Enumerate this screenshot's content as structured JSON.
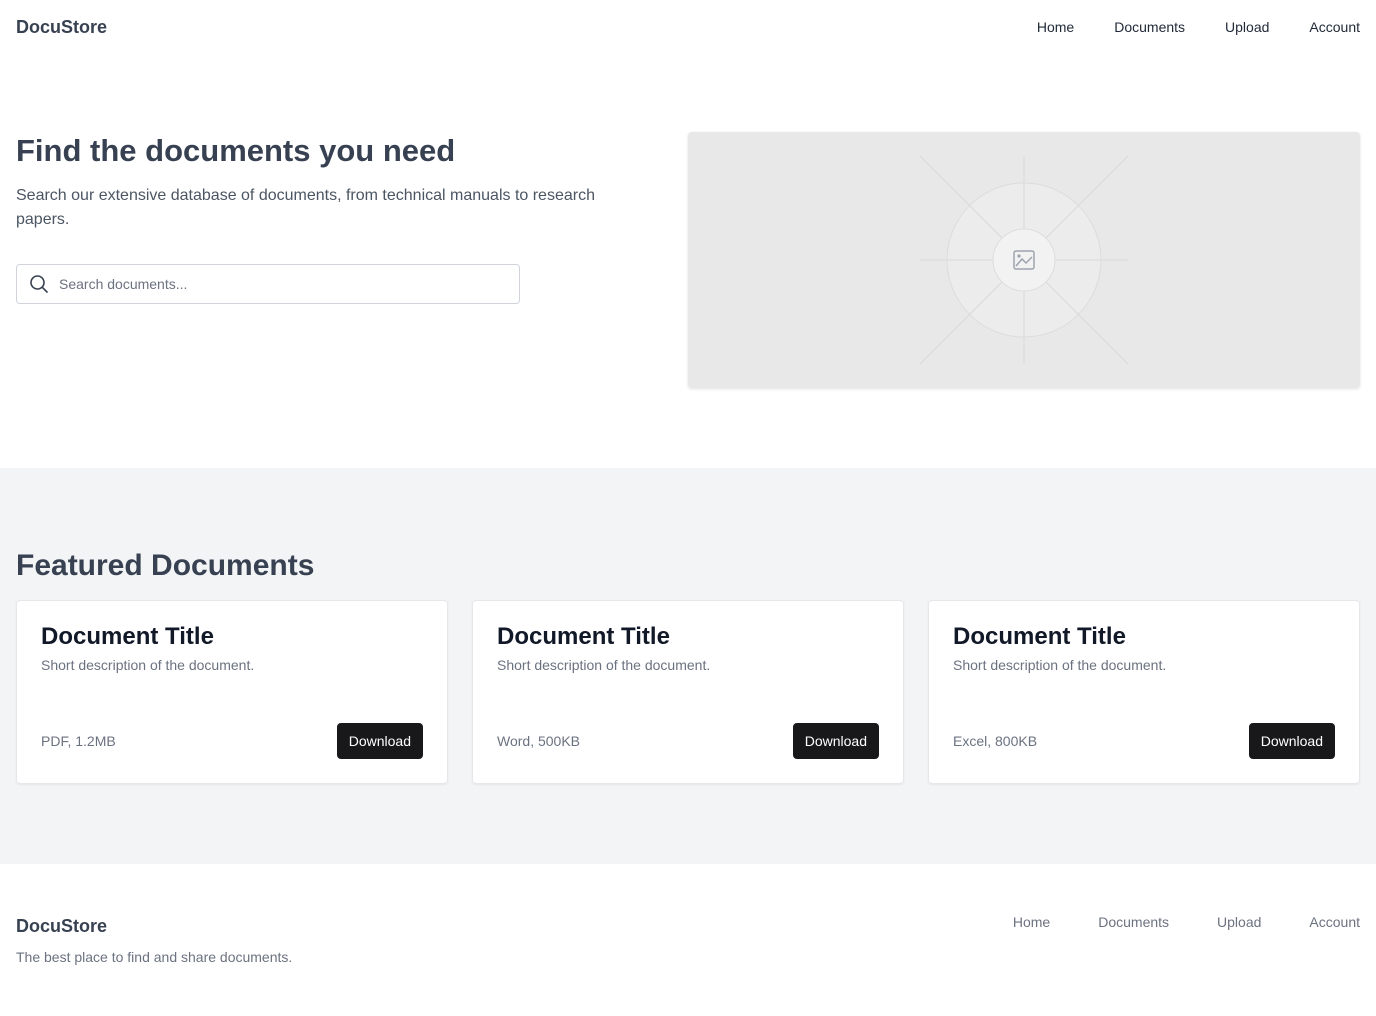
{
  "header": {
    "brand": "DocuStore",
    "nav": [
      "Home",
      "Documents",
      "Upload",
      "Account"
    ]
  },
  "hero": {
    "title": "Find the documents you need",
    "subtitle": "Search our extensive database of documents, from technical manuals to research papers.",
    "search_placeholder": "Search documents...",
    "image_icon": "image-placeholder-icon"
  },
  "featured": {
    "title": "Featured Documents",
    "cards": [
      {
        "title": "Document Title",
        "description": "Short description of the document.",
        "meta": "PDF, 1.2MB",
        "button": "Download"
      },
      {
        "title": "Document Title",
        "description": "Short description of the document.",
        "meta": "Word, 500KB",
        "button": "Download"
      },
      {
        "title": "Document Title",
        "description": "Short description of the document.",
        "meta": "Excel, 800KB",
        "button": "Download"
      }
    ]
  },
  "footer": {
    "brand": "DocuStore",
    "tagline": "The best place to find and share documents.",
    "nav": [
      "Home",
      "Documents",
      "Upload",
      "Account"
    ]
  },
  "colors": {
    "button_bg": "#18181b",
    "section_bg": "#f3f4f6",
    "text_dark": "#374151"
  }
}
